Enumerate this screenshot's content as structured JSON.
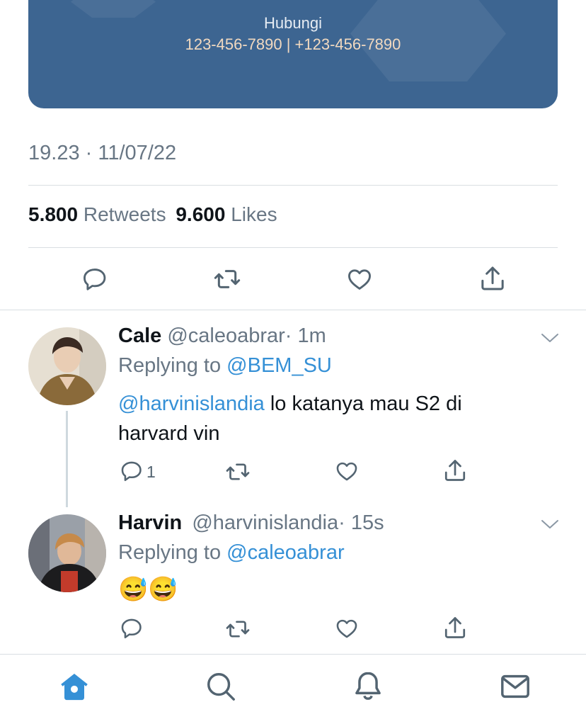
{
  "banner": {
    "title": "Hubungi",
    "phones": "123-456-7890 | +123-456-7890"
  },
  "tweet": {
    "timestamp": "19.23 · 11/07/22",
    "retweets_count": "5.800",
    "retweets_label": "Retweets",
    "likes_count": "9.600",
    "likes_label": "Likes"
  },
  "replies": [
    {
      "name": "Cale",
      "handle": "@caleoabrar",
      "time": "· 1m",
      "replying_prefix": "Replying to",
      "replying_to": "@BEM_SU",
      "mention": "@harvinislandia",
      "text_1": " lo katanya mau S2 di",
      "text_2": "harvard vin",
      "reply_count": "1"
    },
    {
      "name": "Harvin",
      "handle": "@harvinislandia",
      "time": "· 15s",
      "replying_prefix": "Replying to",
      "replying_to": "@caleoabrar",
      "emojis": "😅😅"
    }
  ],
  "colors": {
    "accent": "#3590d6",
    "banner": "#3d6591",
    "secondary_text": "#687684"
  },
  "icons": [
    "reply-icon",
    "retweet-icon",
    "like-icon",
    "share-icon",
    "chevron-down-icon",
    "home-icon",
    "search-icon",
    "notifications-icon",
    "messages-icon"
  ]
}
